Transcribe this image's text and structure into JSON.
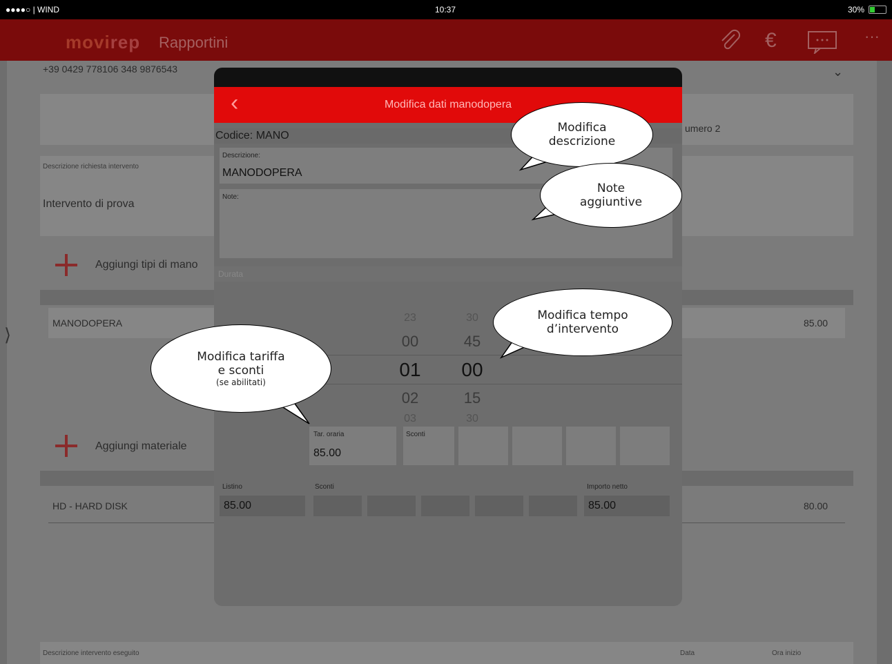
{
  "status_bar": {
    "carrier": "●●●●○ | WIND",
    "time": "10:37",
    "battery": "30%"
  },
  "app": {
    "logo_movi": "movi",
    "logo_rep": "rep",
    "title": "Rapportini"
  },
  "background": {
    "phone": "+39 0429 778106  348 9876543",
    "numero": "umero 2",
    "req_label": "Descrizione richiesta intervento",
    "req_value": "Intervento di prova",
    "add_labour": "Aggiungi tipi di mano",
    "labour_row": {
      "desc": "MANODOPERA",
      "total": "85.00"
    },
    "add_material": "Aggiungi materiale",
    "material_row": {
      "desc": "HD - HARD DISK",
      "total": "80.00"
    },
    "footer_desc": "Descrizione intervento eseguito",
    "footer_data": "Data",
    "footer_ora": "Ora inizio"
  },
  "modal": {
    "title": "Modifica dati manodopera",
    "codice": "Codice: MANO",
    "descrizione_label": "Descrizione:",
    "descrizione_value": "MANODOPERA",
    "note_label": "Note:",
    "durata_label": "Durata",
    "picker": {
      "hours": [
        "23",
        "00",
        "01",
        "02",
        "03"
      ],
      "minutes": [
        "30",
        "45",
        "00",
        "15",
        "30"
      ]
    },
    "tariffa_label": "Tar. oraria",
    "tariffa_value": "85.00",
    "sconti_label": "Sconti",
    "listino_label": "Listino",
    "listino_value": "85.00",
    "sconti2_label": "Sconti",
    "netto_label": "Importo netto",
    "netto_value": "85.00"
  },
  "callouts": {
    "descrizione": [
      "Modifica",
      "descrizione"
    ],
    "note": [
      "Note",
      "aggiuntive"
    ],
    "tempo": [
      "Modifica tempo",
      "d’intervento"
    ],
    "tariffa": [
      "Modifica tariffa",
      "e sconti",
      "(se abilitati)"
    ]
  }
}
